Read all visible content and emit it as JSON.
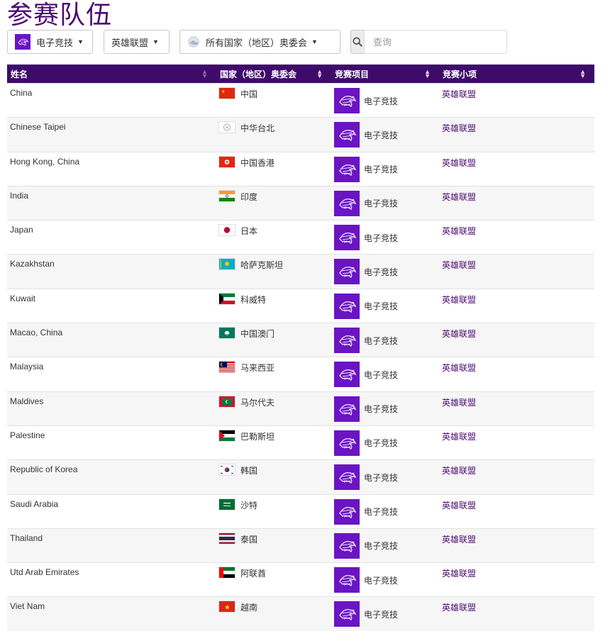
{
  "page_title": "参赛队伍",
  "filters": {
    "sport_label": "电子竞技",
    "event_label": "英雄联盟",
    "noc_label": "所有国家（地区）奥委会",
    "search_placeholder": "查询"
  },
  "table": {
    "headers": [
      "姓名",
      "国家（地区）奥委会",
      "竞赛项目",
      "竞赛小项"
    ],
    "rows": [
      {
        "name": "China",
        "noc": "中国",
        "flag": "china",
        "sport": "电子竞技",
        "event": "英雄联盟"
      },
      {
        "name": "Chinese Taipei",
        "noc": "中华台北",
        "flag": "tpe",
        "sport": "电子竞技",
        "event": "英雄联盟"
      },
      {
        "name": "Hong Kong, China",
        "noc": "中国香港",
        "flag": "hk",
        "sport": "电子竞技",
        "event": "英雄联盟"
      },
      {
        "name": "India",
        "noc": "印度",
        "flag": "india",
        "sport": "电子竞技",
        "event": "英雄联盟"
      },
      {
        "name": "Japan",
        "noc": "日本",
        "flag": "japan",
        "sport": "电子竞技",
        "event": "英雄联盟"
      },
      {
        "name": "Kazakhstan",
        "noc": "哈萨克斯坦",
        "flag": "kaz",
        "sport": "电子竞技",
        "event": "英雄联盟"
      },
      {
        "name": "Kuwait",
        "noc": "科威特",
        "flag": "kuwait",
        "sport": "电子竞技",
        "event": "英雄联盟"
      },
      {
        "name": "Macao, China",
        "noc": "中国澳门",
        "flag": "macao",
        "sport": "电子竞技",
        "event": "英雄联盟"
      },
      {
        "name": "Malaysia",
        "noc": "马来西亚",
        "flag": "malaysia",
        "sport": "电子竞技",
        "event": "英雄联盟"
      },
      {
        "name": "Maldives",
        "noc": "马尔代夫",
        "flag": "maldives",
        "sport": "电子竞技",
        "event": "英雄联盟"
      },
      {
        "name": "Palestine",
        "noc": "巴勒斯坦",
        "flag": "palestine",
        "sport": "电子竞技",
        "event": "英雄联盟"
      },
      {
        "name": "Republic of Korea",
        "noc": "韩国",
        "flag": "korea",
        "sport": "电子竞技",
        "event": "英雄联盟"
      },
      {
        "name": "Saudi Arabia",
        "noc": "沙特",
        "flag": "saudi",
        "sport": "电子竞技",
        "event": "英雄联盟"
      },
      {
        "name": "Thailand",
        "noc": "泰国",
        "flag": "thailand",
        "sport": "电子竞技",
        "event": "英雄联盟"
      },
      {
        "name": "Utd Arab Emirates",
        "noc": "阿联酋",
        "flag": "uae",
        "sport": "电子竞技",
        "event": "英雄联盟"
      },
      {
        "name": "Viet Nam",
        "noc": "越南",
        "flag": "vietnam",
        "sport": "电子竞技",
        "event": "英雄联盟"
      }
    ]
  },
  "colors": {
    "title": "#4b0a72",
    "header_bg": "#3e0b6b",
    "sport_icon_bg": "#6a14c4"
  },
  "icons": {
    "sport": "esports-icon",
    "search": "search-icon",
    "noc": "globe-icon",
    "caret": "caret-down-icon"
  }
}
